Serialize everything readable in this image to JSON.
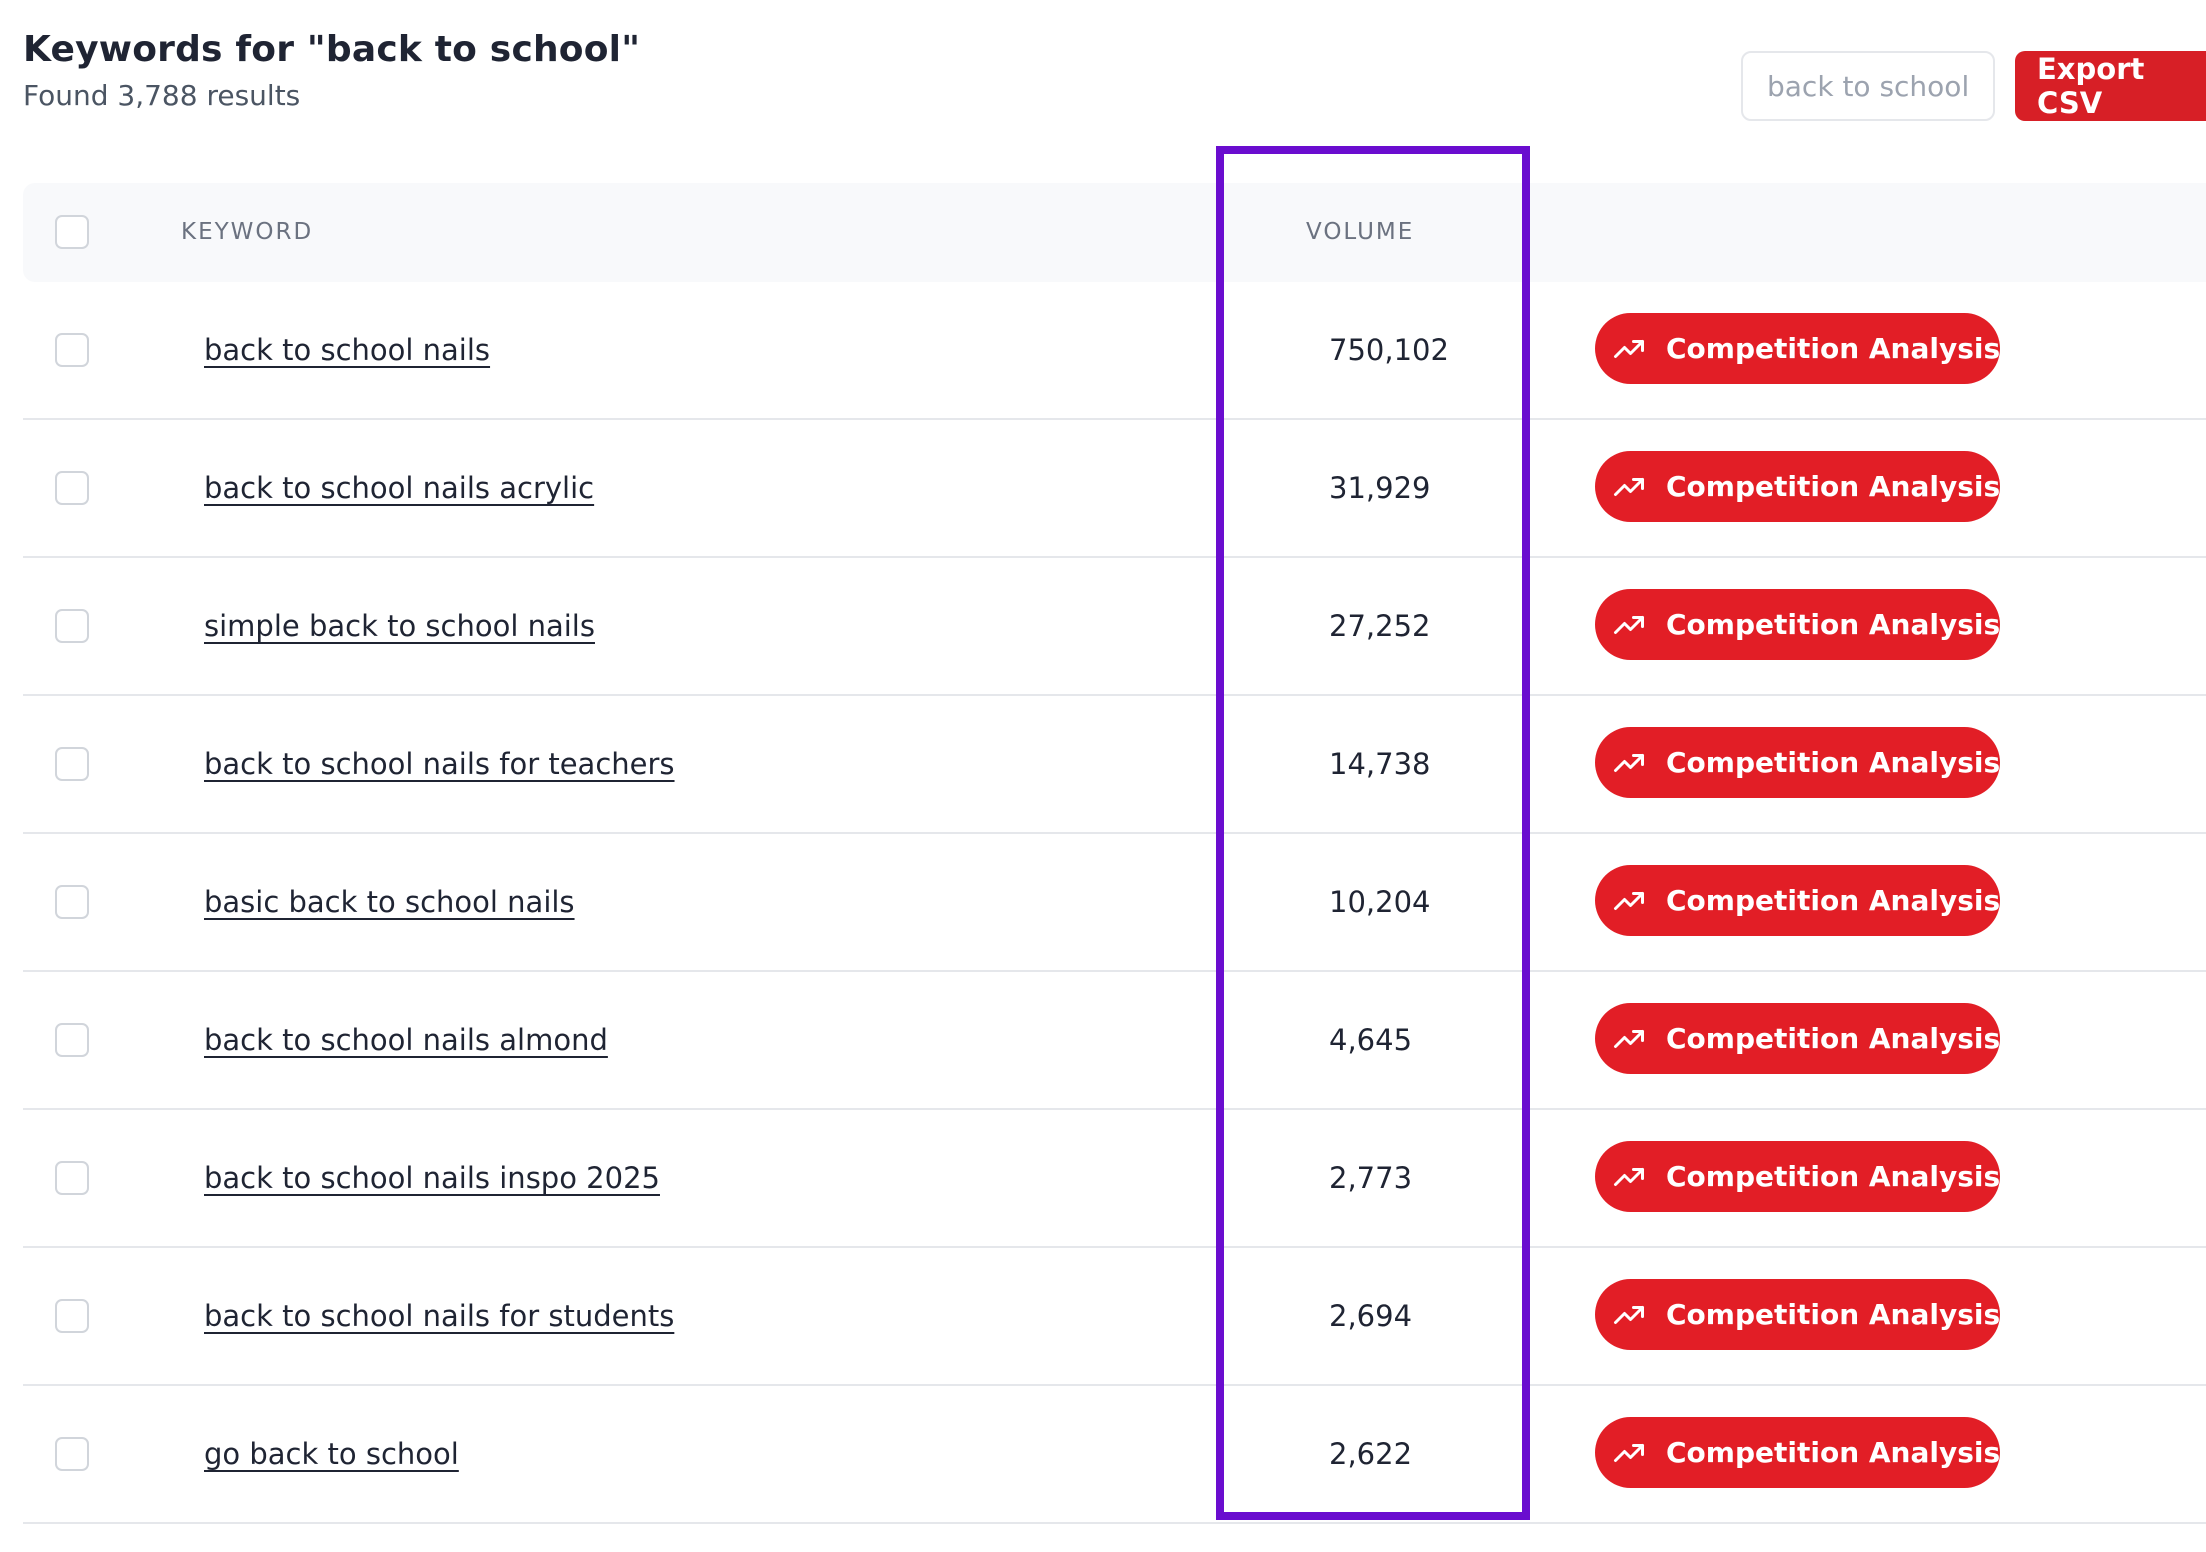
{
  "header": {
    "title": "Keywords for \"back to school\"",
    "results_text": "Found 3,788 results"
  },
  "toolbar": {
    "search_placeholder": "back to school",
    "export_label": "Export CSV"
  },
  "table": {
    "columns": {
      "keyword": "KEYWORD",
      "volume": "VOLUME"
    },
    "action_label": "Competition Analysis",
    "rows": [
      {
        "keyword": "back to school nails",
        "volume": "750,102"
      },
      {
        "keyword": "back to school nails acrylic",
        "volume": "31,929"
      },
      {
        "keyword": "simple back to school nails",
        "volume": "27,252"
      },
      {
        "keyword": "back to school nails for teachers",
        "volume": "14,738"
      },
      {
        "keyword": "basic back to school nails",
        "volume": "10,204"
      },
      {
        "keyword": "back to school nails almond",
        "volume": "4,645"
      },
      {
        "keyword": "back to school nails inspo 2025",
        "volume": "2,773"
      },
      {
        "keyword": "back to school nails for students",
        "volume": "2,694"
      },
      {
        "keyword": "go back to school",
        "volume": "2,622"
      }
    ]
  },
  "colors": {
    "accent": "#e21e26",
    "highlight": "#6a0dcf"
  },
  "icons": {
    "action": "trending-up-icon"
  }
}
